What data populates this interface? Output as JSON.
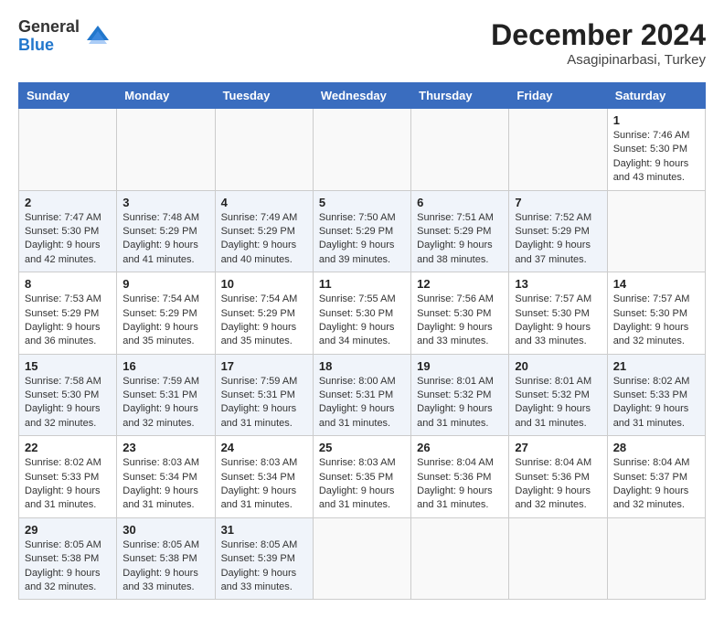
{
  "header": {
    "logo_general": "General",
    "logo_blue": "Blue",
    "month_title": "December 2024",
    "subtitle": "Asagipinarbasi, Turkey"
  },
  "calendar": {
    "days_of_week": [
      "Sunday",
      "Monday",
      "Tuesday",
      "Wednesday",
      "Thursday",
      "Friday",
      "Saturday"
    ],
    "weeks": [
      [
        null,
        null,
        null,
        null,
        null,
        null,
        {
          "day": "1",
          "sunrise": "Sunrise: 7:46 AM",
          "sunset": "Sunset: 5:30 PM",
          "daylight": "Daylight: 9 hours and 43 minutes."
        }
      ],
      [
        {
          "day": "2",
          "sunrise": "Sunrise: 7:47 AM",
          "sunset": "Sunset: 5:30 PM",
          "daylight": "Daylight: 9 hours and 42 minutes."
        },
        {
          "day": "3",
          "sunrise": "Sunrise: 7:48 AM",
          "sunset": "Sunset: 5:29 PM",
          "daylight": "Daylight: 9 hours and 41 minutes."
        },
        {
          "day": "4",
          "sunrise": "Sunrise: 7:49 AM",
          "sunset": "Sunset: 5:29 PM",
          "daylight": "Daylight: 9 hours and 40 minutes."
        },
        {
          "day": "5",
          "sunrise": "Sunrise: 7:50 AM",
          "sunset": "Sunset: 5:29 PM",
          "daylight": "Daylight: 9 hours and 39 minutes."
        },
        {
          "day": "6",
          "sunrise": "Sunrise: 7:51 AM",
          "sunset": "Sunset: 5:29 PM",
          "daylight": "Daylight: 9 hours and 38 minutes."
        },
        {
          "day": "7",
          "sunrise": "Sunrise: 7:52 AM",
          "sunset": "Sunset: 5:29 PM",
          "daylight": "Daylight: 9 hours and 37 minutes."
        },
        null
      ],
      [
        {
          "day": "8",
          "sunrise": "Sunrise: 7:53 AM",
          "sunset": "Sunset: 5:29 PM",
          "daylight": "Daylight: 9 hours and 36 minutes."
        },
        {
          "day": "9",
          "sunrise": "Sunrise: 7:54 AM",
          "sunset": "Sunset: 5:29 PM",
          "daylight": "Daylight: 9 hours and 35 minutes."
        },
        {
          "day": "10",
          "sunrise": "Sunrise: 7:54 AM",
          "sunset": "Sunset: 5:29 PM",
          "daylight": "Daylight: 9 hours and 35 minutes."
        },
        {
          "day": "11",
          "sunrise": "Sunrise: 7:55 AM",
          "sunset": "Sunset: 5:30 PM",
          "daylight": "Daylight: 9 hours and 34 minutes."
        },
        {
          "day": "12",
          "sunrise": "Sunrise: 7:56 AM",
          "sunset": "Sunset: 5:30 PM",
          "daylight": "Daylight: 9 hours and 33 minutes."
        },
        {
          "day": "13",
          "sunrise": "Sunrise: 7:57 AM",
          "sunset": "Sunset: 5:30 PM",
          "daylight": "Daylight: 9 hours and 33 minutes."
        },
        {
          "day": "14",
          "sunrise": "Sunrise: 7:57 AM",
          "sunset": "Sunset: 5:30 PM",
          "daylight": "Daylight: 9 hours and 32 minutes."
        }
      ],
      [
        {
          "day": "15",
          "sunrise": "Sunrise: 7:58 AM",
          "sunset": "Sunset: 5:30 PM",
          "daylight": "Daylight: 9 hours and 32 minutes."
        },
        {
          "day": "16",
          "sunrise": "Sunrise: 7:59 AM",
          "sunset": "Sunset: 5:31 PM",
          "daylight": "Daylight: 9 hours and 32 minutes."
        },
        {
          "day": "17",
          "sunrise": "Sunrise: 7:59 AM",
          "sunset": "Sunset: 5:31 PM",
          "daylight": "Daylight: 9 hours and 31 minutes."
        },
        {
          "day": "18",
          "sunrise": "Sunrise: 8:00 AM",
          "sunset": "Sunset: 5:31 PM",
          "daylight": "Daylight: 9 hours and 31 minutes."
        },
        {
          "day": "19",
          "sunrise": "Sunrise: 8:01 AM",
          "sunset": "Sunset: 5:32 PM",
          "daylight": "Daylight: 9 hours and 31 minutes."
        },
        {
          "day": "20",
          "sunrise": "Sunrise: 8:01 AM",
          "sunset": "Sunset: 5:32 PM",
          "daylight": "Daylight: 9 hours and 31 minutes."
        },
        {
          "day": "21",
          "sunrise": "Sunrise: 8:02 AM",
          "sunset": "Sunset: 5:33 PM",
          "daylight": "Daylight: 9 hours and 31 minutes."
        }
      ],
      [
        {
          "day": "22",
          "sunrise": "Sunrise: 8:02 AM",
          "sunset": "Sunset: 5:33 PM",
          "daylight": "Daylight: 9 hours and 31 minutes."
        },
        {
          "day": "23",
          "sunrise": "Sunrise: 8:03 AM",
          "sunset": "Sunset: 5:34 PM",
          "daylight": "Daylight: 9 hours and 31 minutes."
        },
        {
          "day": "24",
          "sunrise": "Sunrise: 8:03 AM",
          "sunset": "Sunset: 5:34 PM",
          "daylight": "Daylight: 9 hours and 31 minutes."
        },
        {
          "day": "25",
          "sunrise": "Sunrise: 8:03 AM",
          "sunset": "Sunset: 5:35 PM",
          "daylight": "Daylight: 9 hours and 31 minutes."
        },
        {
          "day": "26",
          "sunrise": "Sunrise: 8:04 AM",
          "sunset": "Sunset: 5:36 PM",
          "daylight": "Daylight: 9 hours and 31 minutes."
        },
        {
          "day": "27",
          "sunrise": "Sunrise: 8:04 AM",
          "sunset": "Sunset: 5:36 PM",
          "daylight": "Daylight: 9 hours and 32 minutes."
        },
        {
          "day": "28",
          "sunrise": "Sunrise: 8:04 AM",
          "sunset": "Sunset: 5:37 PM",
          "daylight": "Daylight: 9 hours and 32 minutes."
        }
      ],
      [
        {
          "day": "29",
          "sunrise": "Sunrise: 8:05 AM",
          "sunset": "Sunset: 5:38 PM",
          "daylight": "Daylight: 9 hours and 32 minutes."
        },
        {
          "day": "30",
          "sunrise": "Sunrise: 8:05 AM",
          "sunset": "Sunset: 5:38 PM",
          "daylight": "Daylight: 9 hours and 33 minutes."
        },
        {
          "day": "31",
          "sunrise": "Sunrise: 8:05 AM",
          "sunset": "Sunset: 5:39 PM",
          "daylight": "Daylight: 9 hours and 33 minutes."
        },
        null,
        null,
        null,
        null
      ]
    ]
  }
}
